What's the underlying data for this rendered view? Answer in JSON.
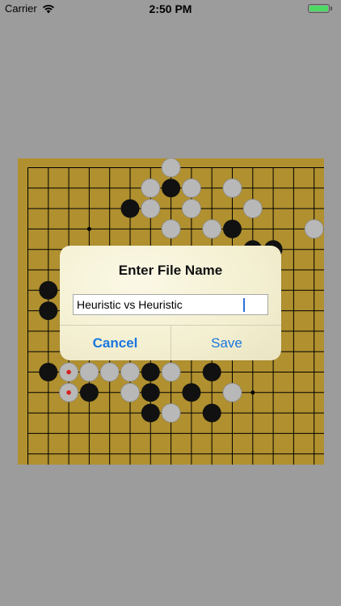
{
  "status_bar": {
    "carrier": "Carrier",
    "time": "2:50 PM",
    "wifi_icon": "wifi-icon",
    "battery_icon": "battery-icon",
    "battery_color": "#4cd964"
  },
  "board": {
    "size": 19,
    "board_color": "#b0902f",
    "grid_color": "#000000",
    "star_points": [
      [
        3,
        3
      ],
      [
        11,
        11
      ]
    ],
    "black_stones": [
      [
        7,
        1
      ],
      [
        5,
        2
      ],
      [
        6,
        2
      ],
      [
        10,
        3
      ],
      [
        11,
        4
      ],
      [
        12,
        4
      ],
      [
        1,
        6
      ],
      [
        1,
        7
      ],
      [
        1,
        10
      ],
      [
        3,
        10
      ],
      [
        6,
        10
      ],
      [
        9,
        10
      ],
      [
        3,
        11
      ],
      [
        6,
        11
      ],
      [
        8,
        11
      ],
      [
        6,
        12
      ],
      [
        9,
        12
      ]
    ],
    "white_stones": [
      [
        7,
        0
      ],
      [
        6,
        1
      ],
      [
        8,
        1
      ],
      [
        10,
        1
      ],
      [
        6,
        2
      ],
      [
        8,
        2
      ],
      [
        11,
        2
      ],
      [
        7,
        3
      ],
      [
        9,
        3
      ],
      [
        14,
        3
      ],
      [
        2,
        10
      ],
      [
        3,
        10
      ],
      [
        4,
        10
      ],
      [
        5,
        10
      ],
      [
        7,
        10
      ],
      [
        2,
        11
      ],
      [
        5,
        11
      ],
      [
        10,
        11
      ],
      [
        7,
        12
      ]
    ],
    "marked_stones": [
      [
        2,
        10
      ],
      [
        2,
        11
      ]
    ],
    "marker_color": "#d82020"
  },
  "dialog": {
    "title": "Enter File Name",
    "input_value": "Heuristic vs Heuristic",
    "cancel_label": "Cancel",
    "save_label": "Save",
    "button_color": "#1976e0"
  }
}
